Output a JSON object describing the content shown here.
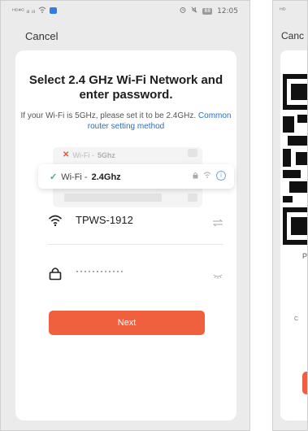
{
  "left_screen": {
    "status_bar": {
      "left_text": "ᴴᴰ⁴ᴳ ᵢₗₗ ᵢₗₗ",
      "time": "12:05",
      "battery": "88"
    },
    "cancel_label": "Cancel",
    "title": "Select 2.4 GHz Wi-Fi Network and enter password.",
    "hint_text": "If your Wi-Fi is 5GHz, please set it to be 2.4GHz.",
    "hint_link": "Common router setting method",
    "illustration": {
      "bad_option_prefix": "Wi-Fi - ",
      "bad_option_band": "5Ghz",
      "good_option_prefix": "Wi-Fi - ",
      "good_option_band": "2.4Ghz"
    },
    "wifi_field": {
      "value": "TPWS-1912",
      "icon": "wifi-icon",
      "action_icon": "switch-network-icon"
    },
    "password_field": {
      "value": "············",
      "icon": "lock-icon",
      "action_icon": "eye-closed-icon"
    },
    "next_button_label": "Next"
  },
  "right_screen": {
    "cancel_label": "Canc",
    "letter_p": "P",
    "letter_c": "C",
    "qr_icon": "qr-code-icon"
  },
  "colors": {
    "accent": "#f0603f",
    "link": "#2a6fc4",
    "check": "#3bb37a",
    "cross": "#e9543a",
    "page_bg": "#ebebeb"
  }
}
